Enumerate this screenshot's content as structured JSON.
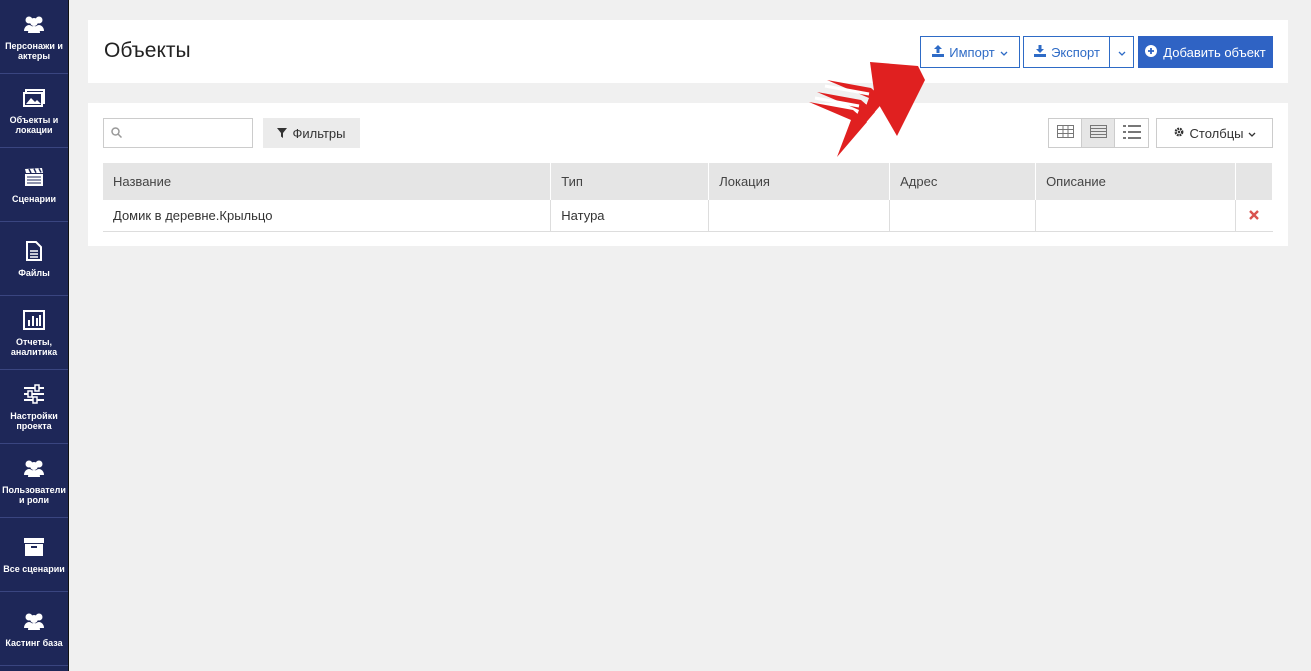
{
  "sidebar": {
    "items": [
      {
        "label": "Персонажи и актеры",
        "icon": "users-icon"
      },
      {
        "label": "Объекты и локации",
        "icon": "image-icon"
      },
      {
        "label": "Сценарии",
        "icon": "clapperboard-icon"
      },
      {
        "label": "Файлы",
        "icon": "file-icon"
      },
      {
        "label": "Отчеты, аналитика",
        "icon": "bar-chart-icon"
      },
      {
        "label": "Настройки проекта",
        "icon": "sliders-icon"
      },
      {
        "label": "Пользователи и роли",
        "icon": "users-icon"
      },
      {
        "label": "Все сценарии",
        "icon": "archive-icon"
      },
      {
        "label": "Кастинг база",
        "icon": "users-icon"
      }
    ]
  },
  "header": {
    "title": "Объекты",
    "import_label": "Импорт",
    "export_label": "Экспорт",
    "add_label": "Добавить объект"
  },
  "toolbar": {
    "search_placeholder": "",
    "filters_label": "Фильтры",
    "columns_label": "Столбцы"
  },
  "table": {
    "headers": [
      "Название",
      "Тип",
      "Локация",
      "Адрес",
      "Описание"
    ],
    "rows": [
      {
        "name": "Домик в деревне.Крыльцо",
        "type": "Натура",
        "location": "",
        "address": "",
        "description": ""
      }
    ]
  },
  "colors": {
    "sidebar_bg": "#1e2758",
    "primary": "#2f63c4",
    "delete": "#d9534f",
    "arrow": "#e02020"
  }
}
